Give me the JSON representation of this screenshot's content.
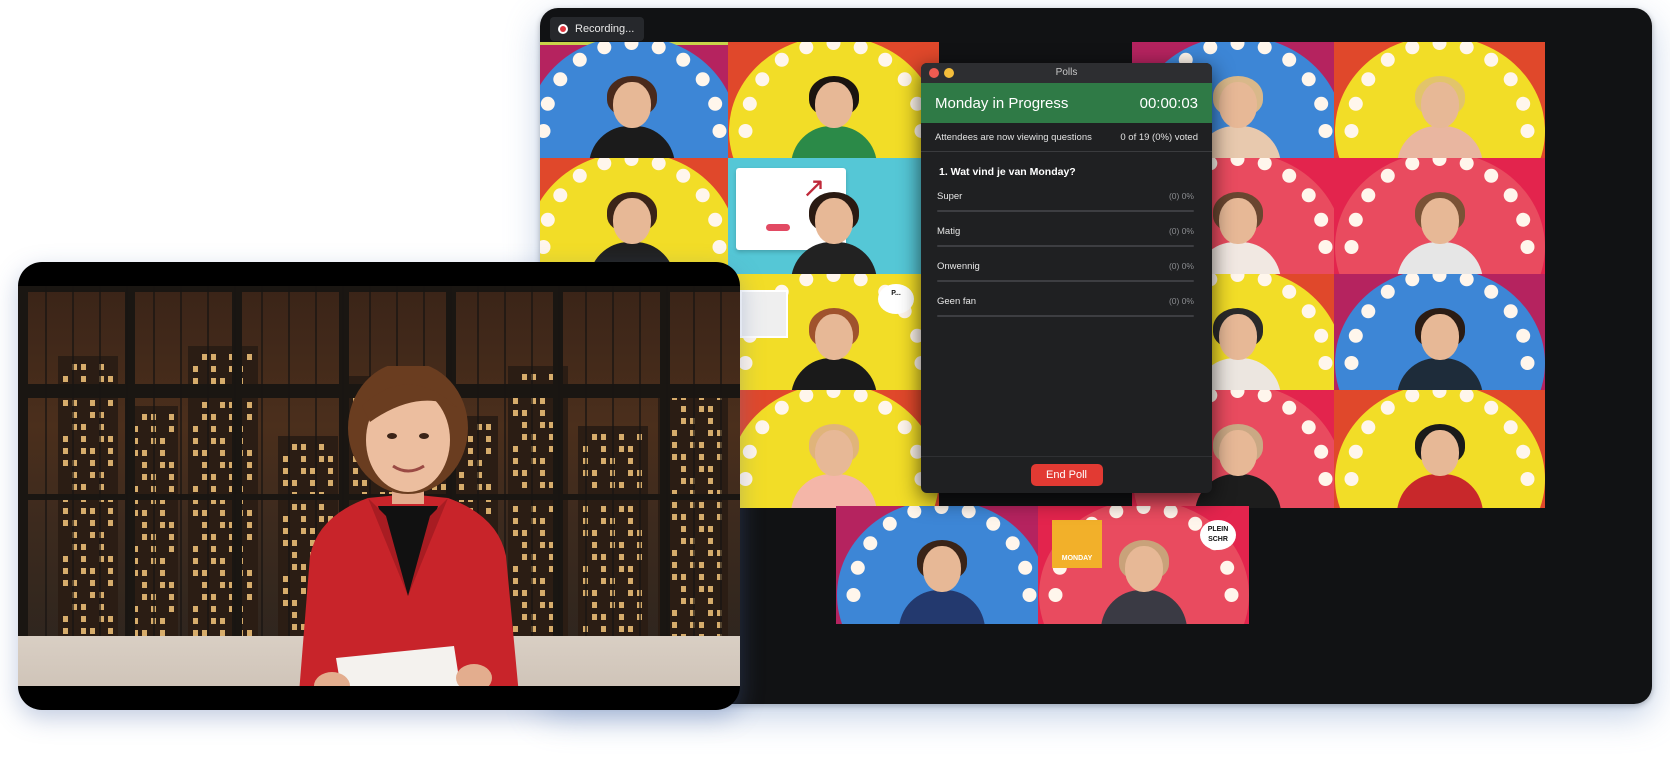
{
  "zoom": {
    "recording_label": "Recording...",
    "accent_colors": {
      "active_speaker_border": "#c9d44a",
      "recording_dot": "#e0353f"
    }
  },
  "polls": {
    "window_title": "Polls",
    "poll_name": "Monday in Progress",
    "timer": "00:00:03",
    "status_text": "Attendees are now viewing questions",
    "vote_summary": "0 of 19 (0%) voted",
    "question": "1. Wat vind je van Monday?",
    "options": [
      {
        "label": "Super",
        "count": "(0) 0%",
        "fraction": 0
      },
      {
        "label": "Matig",
        "count": "(0) 0%",
        "fraction": 0
      },
      {
        "label": "Onwennig",
        "count": "(0) 0%",
        "fraction": 0
      },
      {
        "label": "Geen fan",
        "count": "(0) 0%",
        "fraction": 0
      }
    ],
    "end_poll_label": "End Poll",
    "colors": {
      "header": "#2f7a46",
      "end_button": "#e23a33"
    }
  },
  "participants": {
    "speech_bubble_1": "P...",
    "speech_bubble_2": "PLEIN SCHR",
    "sponsor_sign": "MONDAY"
  }
}
